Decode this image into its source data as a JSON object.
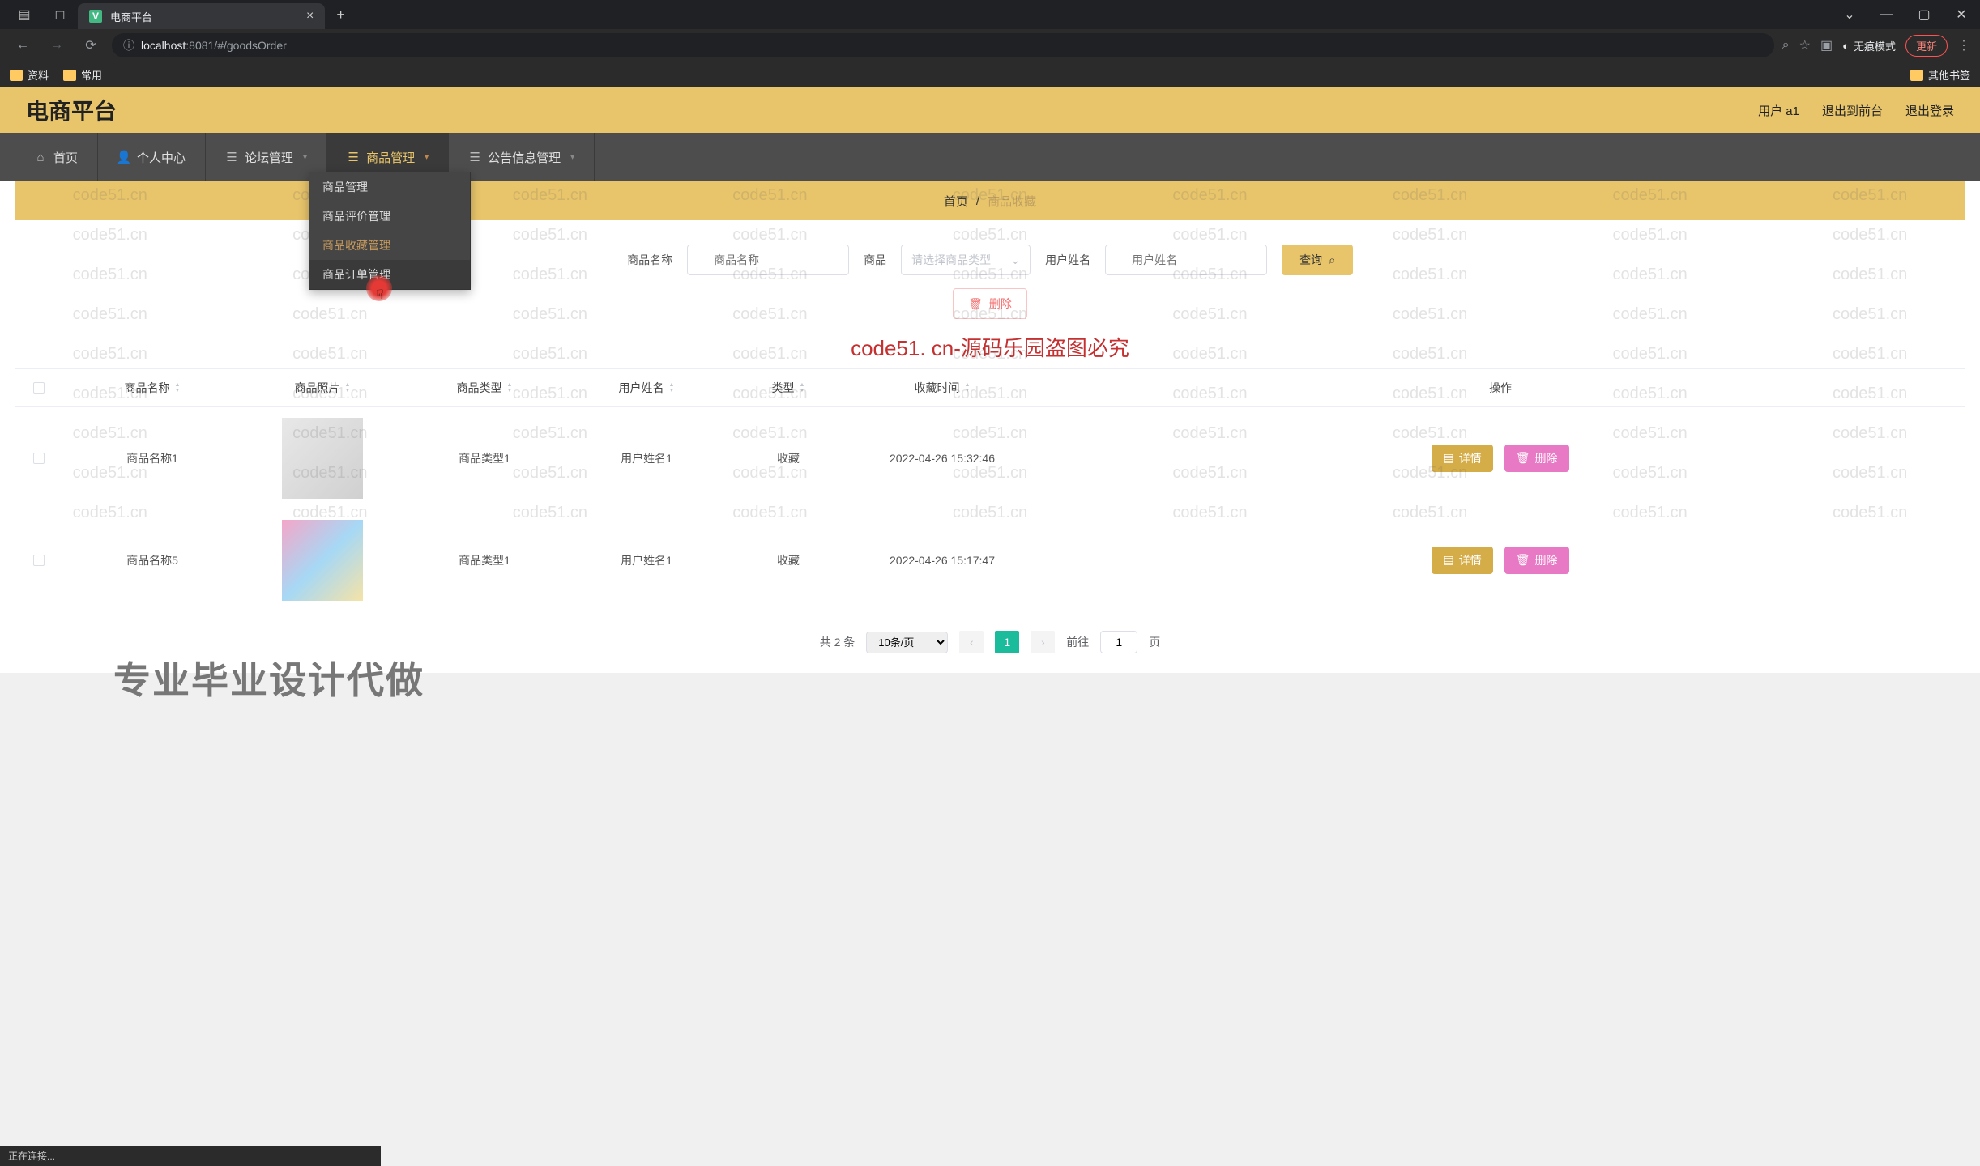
{
  "browser": {
    "tab_title": "电商平台",
    "url_secure_icon": "ⓘ",
    "url_host_prefix": "localhost",
    "url_port_path": ":8081/#/goodsOrder",
    "incognito_label": "无痕模式",
    "update_label": "更新",
    "bookmarks": [
      "资料",
      "常用"
    ],
    "other_bookmarks": "其他书签"
  },
  "header": {
    "site_title": "电商平台",
    "user_label": "用户 a1",
    "back_front_label": "退出到前台",
    "logout_label": "退出登录"
  },
  "nav": {
    "items": [
      {
        "icon": "home",
        "label": "首页",
        "caret": false
      },
      {
        "icon": "user",
        "label": "个人中心",
        "caret": false
      },
      {
        "icon": "list",
        "label": "论坛管理",
        "caret": true
      },
      {
        "icon": "menu",
        "label": "商品管理",
        "caret": true
      },
      {
        "icon": "bell",
        "label": "公告信息管理",
        "caret": true
      }
    ]
  },
  "dropdown": {
    "items": [
      "商品管理",
      "商品评价管理",
      "商品收藏管理",
      "商品订单管理"
    ]
  },
  "breadcrumb": {
    "home": "首页",
    "sep": "/",
    "current": "商品收藏"
  },
  "search": {
    "name_label": "商品名称",
    "name_placeholder": "商品名称",
    "type_label": "商品",
    "type_select_placeholder": "请选择商品类型",
    "user_label": "用户姓名",
    "user_placeholder": "用户姓名",
    "query_btn": "查询"
  },
  "delete_btn_label": "删除",
  "watermark_center": "code51. cn-源码乐园盗图必究",
  "watermark_text": "code51.cn",
  "overlay_big_text": "专业毕业设计代做",
  "table": {
    "headers": {
      "name": "商品名称",
      "photo": "商品照片",
      "type": "商品类型",
      "user": "用户姓名",
      "category": "类型",
      "time": "收藏时间",
      "action": "操作"
    },
    "rows": [
      {
        "name": "商品名称1",
        "type": "商品类型1",
        "user": "用户姓名1",
        "category": "收藏",
        "time": "2022-04-26 15:32:46"
      },
      {
        "name": "商品名称5",
        "type": "商品类型1",
        "user": "用户姓名1",
        "category": "收藏",
        "time": "2022-04-26 15:17:47"
      }
    ],
    "detail_btn": "详情",
    "delete_btn": "删除"
  },
  "pagination": {
    "total_prefix": "共",
    "total_count": "2",
    "total_suffix": "条",
    "page_size": "10条/页",
    "current_page": "1",
    "jump_prefix": "前往",
    "jump_value": "1",
    "jump_suffix": "页"
  },
  "status_bar": "正在连接..."
}
